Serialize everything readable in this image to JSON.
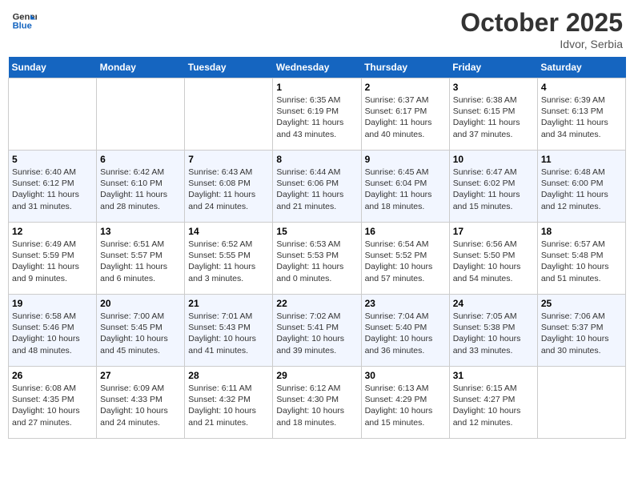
{
  "header": {
    "logo_line1": "General",
    "logo_line2": "Blue",
    "month": "October 2025",
    "location": "Idvor, Serbia"
  },
  "weekdays": [
    "Sunday",
    "Monday",
    "Tuesday",
    "Wednesday",
    "Thursday",
    "Friday",
    "Saturday"
  ],
  "weeks": [
    [
      {
        "day": "",
        "info": ""
      },
      {
        "day": "",
        "info": ""
      },
      {
        "day": "",
        "info": ""
      },
      {
        "day": "1",
        "info": "Sunrise: 6:35 AM\nSunset: 6:19 PM\nDaylight: 11 hours and 43 minutes."
      },
      {
        "day": "2",
        "info": "Sunrise: 6:37 AM\nSunset: 6:17 PM\nDaylight: 11 hours and 40 minutes."
      },
      {
        "day": "3",
        "info": "Sunrise: 6:38 AM\nSunset: 6:15 PM\nDaylight: 11 hours and 37 minutes."
      },
      {
        "day": "4",
        "info": "Sunrise: 6:39 AM\nSunset: 6:13 PM\nDaylight: 11 hours and 34 minutes."
      }
    ],
    [
      {
        "day": "5",
        "info": "Sunrise: 6:40 AM\nSunset: 6:12 PM\nDaylight: 11 hours and 31 minutes."
      },
      {
        "day": "6",
        "info": "Sunrise: 6:42 AM\nSunset: 6:10 PM\nDaylight: 11 hours and 28 minutes."
      },
      {
        "day": "7",
        "info": "Sunrise: 6:43 AM\nSunset: 6:08 PM\nDaylight: 11 hours and 24 minutes."
      },
      {
        "day": "8",
        "info": "Sunrise: 6:44 AM\nSunset: 6:06 PM\nDaylight: 11 hours and 21 minutes."
      },
      {
        "day": "9",
        "info": "Sunrise: 6:45 AM\nSunset: 6:04 PM\nDaylight: 11 hours and 18 minutes."
      },
      {
        "day": "10",
        "info": "Sunrise: 6:47 AM\nSunset: 6:02 PM\nDaylight: 11 hours and 15 minutes."
      },
      {
        "day": "11",
        "info": "Sunrise: 6:48 AM\nSunset: 6:00 PM\nDaylight: 11 hours and 12 minutes."
      }
    ],
    [
      {
        "day": "12",
        "info": "Sunrise: 6:49 AM\nSunset: 5:59 PM\nDaylight: 11 hours and 9 minutes."
      },
      {
        "day": "13",
        "info": "Sunrise: 6:51 AM\nSunset: 5:57 PM\nDaylight: 11 hours and 6 minutes."
      },
      {
        "day": "14",
        "info": "Sunrise: 6:52 AM\nSunset: 5:55 PM\nDaylight: 11 hours and 3 minutes."
      },
      {
        "day": "15",
        "info": "Sunrise: 6:53 AM\nSunset: 5:53 PM\nDaylight: 11 hours and 0 minutes."
      },
      {
        "day": "16",
        "info": "Sunrise: 6:54 AM\nSunset: 5:52 PM\nDaylight: 10 hours and 57 minutes."
      },
      {
        "day": "17",
        "info": "Sunrise: 6:56 AM\nSunset: 5:50 PM\nDaylight: 10 hours and 54 minutes."
      },
      {
        "day": "18",
        "info": "Sunrise: 6:57 AM\nSunset: 5:48 PM\nDaylight: 10 hours and 51 minutes."
      }
    ],
    [
      {
        "day": "19",
        "info": "Sunrise: 6:58 AM\nSunset: 5:46 PM\nDaylight: 10 hours and 48 minutes."
      },
      {
        "day": "20",
        "info": "Sunrise: 7:00 AM\nSunset: 5:45 PM\nDaylight: 10 hours and 45 minutes."
      },
      {
        "day": "21",
        "info": "Sunrise: 7:01 AM\nSunset: 5:43 PM\nDaylight: 10 hours and 41 minutes."
      },
      {
        "day": "22",
        "info": "Sunrise: 7:02 AM\nSunset: 5:41 PM\nDaylight: 10 hours and 39 minutes."
      },
      {
        "day": "23",
        "info": "Sunrise: 7:04 AM\nSunset: 5:40 PM\nDaylight: 10 hours and 36 minutes."
      },
      {
        "day": "24",
        "info": "Sunrise: 7:05 AM\nSunset: 5:38 PM\nDaylight: 10 hours and 33 minutes."
      },
      {
        "day": "25",
        "info": "Sunrise: 7:06 AM\nSunset: 5:37 PM\nDaylight: 10 hours and 30 minutes."
      }
    ],
    [
      {
        "day": "26",
        "info": "Sunrise: 6:08 AM\nSunset: 4:35 PM\nDaylight: 10 hours and 27 minutes."
      },
      {
        "day": "27",
        "info": "Sunrise: 6:09 AM\nSunset: 4:33 PM\nDaylight: 10 hours and 24 minutes."
      },
      {
        "day": "28",
        "info": "Sunrise: 6:11 AM\nSunset: 4:32 PM\nDaylight: 10 hours and 21 minutes."
      },
      {
        "day": "29",
        "info": "Sunrise: 6:12 AM\nSunset: 4:30 PM\nDaylight: 10 hours and 18 minutes."
      },
      {
        "day": "30",
        "info": "Sunrise: 6:13 AM\nSunset: 4:29 PM\nDaylight: 10 hours and 15 minutes."
      },
      {
        "day": "31",
        "info": "Sunrise: 6:15 AM\nSunset: 4:27 PM\nDaylight: 10 hours and 12 minutes."
      },
      {
        "day": "",
        "info": ""
      }
    ]
  ]
}
